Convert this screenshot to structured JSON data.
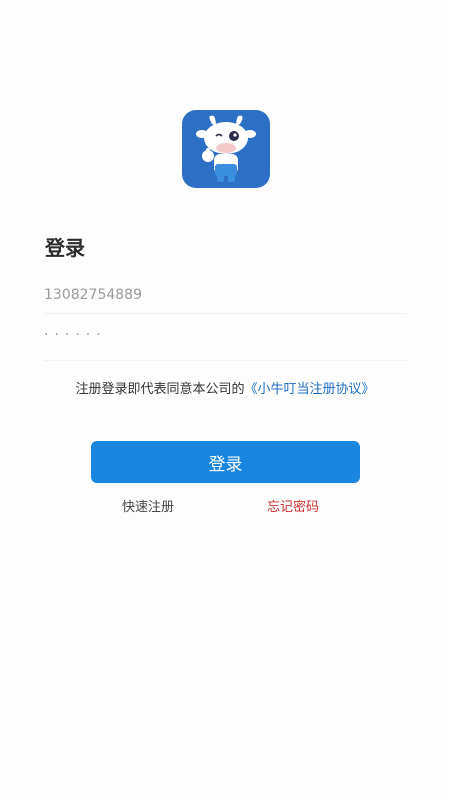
{
  "app": {
    "logo_icon": "cow-mascot-icon",
    "brand_color": "#2c6fc4"
  },
  "login": {
    "title": "登录",
    "phone_value": "13082754889",
    "password_mask": "······",
    "agreement_prefix": "注册登录即代表同意本公司的",
    "agreement_link": "《小牛叮当注册协议》",
    "login_button": "登录",
    "register_link": "快速注册",
    "forgot_link": "忘记密码"
  },
  "colors": {
    "primary_button": "#1a86e0",
    "link_blue": "#1f6fbf",
    "forgot_red": "#d0312d"
  }
}
